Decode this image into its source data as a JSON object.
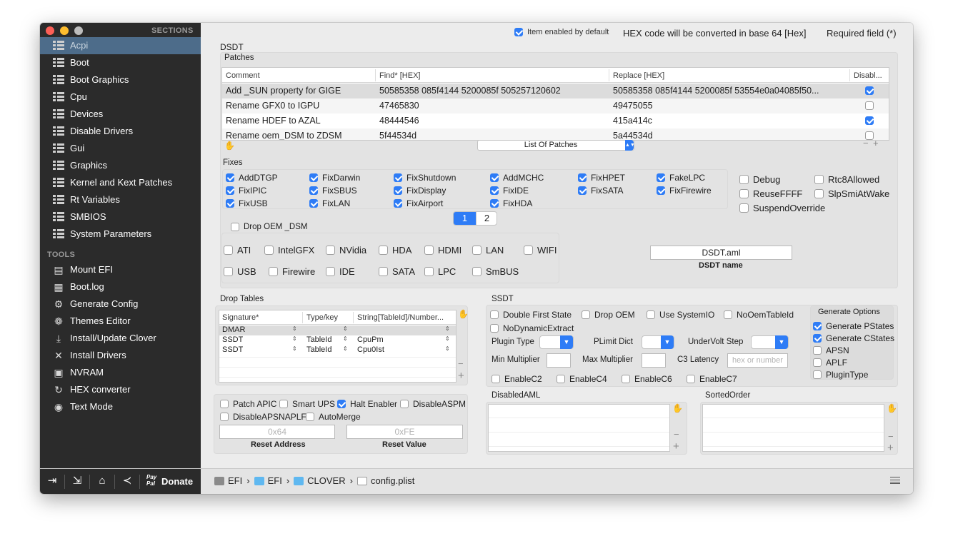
{
  "sidebar": {
    "sections_label": "SECTIONS",
    "sections": [
      "Acpi",
      "Boot",
      "Boot Graphics",
      "Cpu",
      "Devices",
      "Disable Drivers",
      "Gui",
      "Graphics",
      "Kernel and Kext Patches",
      "Rt Variables",
      "SMBIOS",
      "System Parameters"
    ],
    "tools_label": "TOOLS",
    "tools": [
      {
        "label": "Mount EFI",
        "icon": "disk-icon"
      },
      {
        "label": "Boot.log",
        "icon": "log-icon"
      },
      {
        "label": "Generate Config",
        "icon": "gears-icon"
      },
      {
        "label": "Themes Editor",
        "icon": "palette-icon"
      },
      {
        "label": "Install/Update Clover",
        "icon": "download-icon"
      },
      {
        "label": "Install Drivers",
        "icon": "tools-icon"
      },
      {
        "label": "NVRAM",
        "icon": "chip-icon"
      },
      {
        "label": "HEX converter",
        "icon": "refresh-icon"
      },
      {
        "label": "Text Mode",
        "icon": "eye-icon"
      }
    ]
  },
  "header": {
    "enabled_default": "Item enabled by default",
    "hex_note": "HEX code will be converted in base 64 [Hex]",
    "required": "Required field (*)"
  },
  "dsdt": {
    "label": "DSDT",
    "patches_label": "Patches",
    "columns": [
      "Comment",
      "Find* [HEX]",
      "Replace [HEX]",
      "Disabl..."
    ],
    "rows": [
      {
        "comment": "Add _SUN property for GIGE",
        "find": "50585358 085f4144 5200085f 505257120602",
        "replace": "50585358 085f4144 5200085f 53554e0a04085f50...",
        "disabled": true
      },
      {
        "comment": "Rename GFX0 to IGPU",
        "find": "47465830",
        "replace": "49475055",
        "disabled": false
      },
      {
        "comment": "Rename HDEF to AZAL",
        "find": "48444546",
        "replace": "415a414c",
        "disabled": true
      },
      {
        "comment": "Rename oem_DSM to ZDSM",
        "find": "5f44534d",
        "replace": "5a44534d",
        "disabled": false
      }
    ],
    "list_of_patches": "List Of Patches",
    "fixes_label": "Fixes",
    "fixes": [
      {
        "l": "AddDTGP",
        "c": true
      },
      {
        "l": "FixDarwin",
        "c": true
      },
      {
        "l": "FixShutdown",
        "c": true
      },
      {
        "l": "AddMCHC",
        "c": true
      },
      {
        "l": "FixHPET",
        "c": true
      },
      {
        "l": "FakeLPC",
        "c": true
      },
      {
        "l": "FixIPIC",
        "c": true
      },
      {
        "l": "FixSBUS",
        "c": true
      },
      {
        "l": "FixDisplay",
        "c": true
      },
      {
        "l": "FixIDE",
        "c": true
      },
      {
        "l": "FixSATA",
        "c": true
      },
      {
        "l": "FixFirewire",
        "c": true
      },
      {
        "l": "FixUSB",
        "c": true
      },
      {
        "l": "FixLAN",
        "c": true
      },
      {
        "l": "FixAirport",
        "c": true
      },
      {
        "l": "FixHDA",
        "c": true
      }
    ],
    "side_opts": [
      {
        "l": "Debug",
        "c": false
      },
      {
        "l": "Rtc8Allowed",
        "c": false
      },
      {
        "l": "ReuseFFFF",
        "c": false
      },
      {
        "l": "SlpSmiAtWake",
        "c": false
      },
      {
        "l": "SuspendOverride",
        "c": false
      }
    ],
    "pages": [
      "1",
      "2"
    ],
    "drop_oem_dsm": "Drop OEM _DSM",
    "dsm_items": [
      "ATI",
      "IntelGFX",
      "NVidia",
      "HDA",
      "HDMI",
      "LAN",
      "WIFI",
      "USB",
      "Firewire",
      "IDE",
      "SATA",
      "LPC",
      "SmBUS"
    ],
    "dsdt_name_value": "DSDT.aml",
    "dsdt_name_label": "DSDT name"
  },
  "drop_tables": {
    "label": "Drop Tables",
    "columns": [
      "Signature*",
      "Type/key",
      "String[TableId]/Number..."
    ],
    "rows": [
      {
        "sig": "DMAR",
        "type": "",
        "str": ""
      },
      {
        "sig": "SSDT",
        "type": "TableId",
        "str": "CpuPm"
      },
      {
        "sig": "SSDT",
        "type": "TableId",
        "str": "Cpu0Ist"
      }
    ]
  },
  "misc": {
    "opts": [
      {
        "l": "Patch APIC",
        "c": false
      },
      {
        "l": "Smart UPS",
        "c": false
      },
      {
        "l": "Halt Enabler",
        "c": true
      },
      {
        "l": "DisableASPM",
        "c": false
      },
      {
        "l": "DisableAPSNAPLF",
        "c": false
      },
      {
        "l": "AutoMerge",
        "c": false
      }
    ],
    "reset_address_ph": "0x64",
    "reset_address_label": "Reset Address",
    "reset_value_ph": "0xFE",
    "reset_value_label": "Reset Value"
  },
  "ssdt": {
    "label": "SSDT",
    "opts": [
      {
        "l": "Double First State",
        "c": false
      },
      {
        "l": "Drop OEM",
        "c": false
      },
      {
        "l": "Use SystemIO",
        "c": false
      },
      {
        "l": "NoOemTableId",
        "c": false
      },
      {
        "l": "NoDynamicExtract",
        "c": false
      }
    ],
    "plugin_type": "Plugin Type",
    "plimit_dict": "PLimit Dict",
    "undervolt_step": "UnderVolt Step",
    "min_multiplier": "Min Multiplier",
    "max_multiplier": "Max Multiplier",
    "c3_latency": "C3 Latency",
    "c3_ph": "hex or number",
    "enable_c": [
      {
        "l": "EnableC2",
        "c": false
      },
      {
        "l": "EnableC4",
        "c": false
      },
      {
        "l": "EnableC6",
        "c": false
      },
      {
        "l": "EnableC7",
        "c": false
      }
    ],
    "gen_label": "Generate Options",
    "gen": [
      {
        "l": "Generate PStates",
        "c": true
      },
      {
        "l": "Generate CStates",
        "c": true
      },
      {
        "l": "APSN",
        "c": false
      },
      {
        "l": "APLF",
        "c": false
      },
      {
        "l": "PluginType",
        "c": false
      }
    ]
  },
  "disabled_aml_label": "DisabledAML",
  "sorted_order_label": "SortedOrder",
  "footer": {
    "donate": "Donate",
    "paypal": "Pay Pal",
    "path": [
      "EFI",
      "EFI",
      "CLOVER",
      "config.plist"
    ]
  }
}
